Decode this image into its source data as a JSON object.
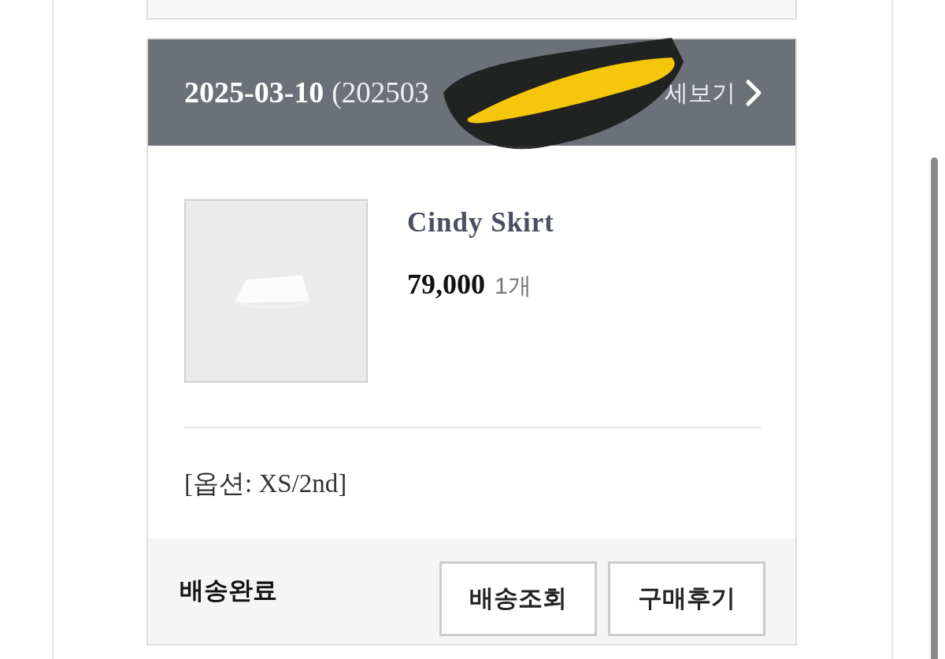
{
  "header": {
    "date": "2025-03-10",
    "order_number": "(202503",
    "link": "세보기"
  },
  "product": {
    "name": "Cindy Skirt",
    "price": "79,000",
    "quantity": "1개",
    "option": "[옵션: XS/2nd]"
  },
  "footer": {
    "status": "배송완료",
    "buttons": [
      "배송조회",
      "구매후기"
    ]
  }
}
